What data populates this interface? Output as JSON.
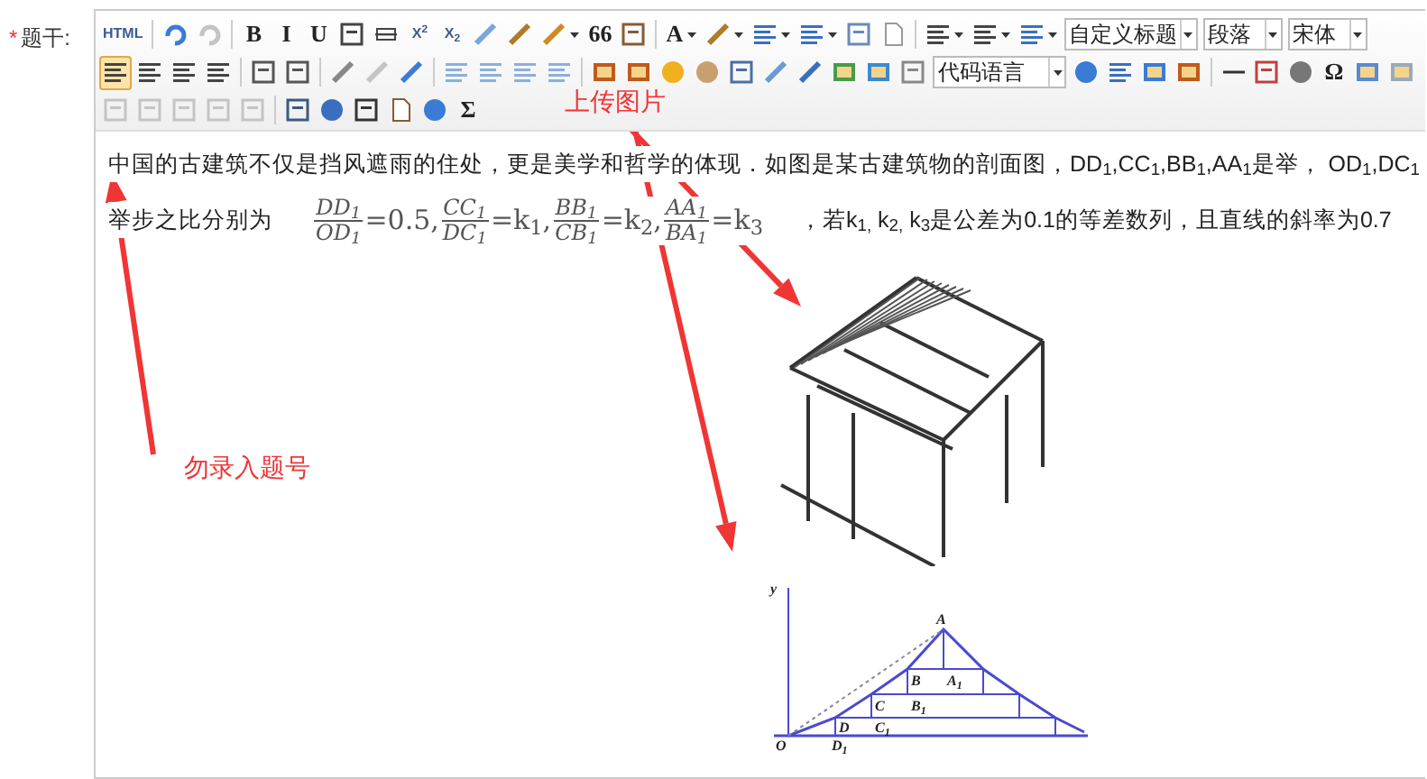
{
  "field": {
    "required_mark": "*",
    "label": "题干:"
  },
  "toolbar": {
    "rows": [
      [
        {
          "kind": "text",
          "label": "HTML"
        },
        {
          "kind": "sep"
        },
        {
          "kind": "icon"
        },
        {
          "kind": "icon",
          "disabled": true
        },
        {
          "kind": "sep"
        },
        {
          "kind": "text",
          "label": "B"
        },
        {
          "kind": "text",
          "label": "I"
        },
        {
          "kind": "text",
          "label": "U"
        },
        {
          "kind": "icon"
        },
        {
          "kind": "icon"
        },
        {
          "kind": "text",
          "label": "X$^{2}$"
        },
        {
          "kind": "text",
          "label": "X$_{2}$"
        },
        {
          "kind": "icon"
        },
        {
          "kind": "icon"
        },
        {
          "kind": "icon",
          "dropdown": true
        },
        {
          "kind": "text",
          "label": "66"
        },
        {
          "kind": "icon"
        },
        {
          "kind": "sep"
        },
        {
          "kind": "text",
          "label": "A",
          "dropdown": true
        },
        {
          "kind": "icon",
          "dropdown": true
        },
        {
          "kind": "icon",
          "dropdown": true
        },
        {
          "kind": "icon",
          "dropdown": true
        },
        {
          "kind": "icon"
        },
        {
          "kind": "icon"
        },
        {
          "kind": "sep"
        },
        {
          "kind": "icon",
          "dropdown": true
        },
        {
          "kind": "icon",
          "dropdown": true
        },
        {
          "kind": "icon",
          "dropdown": true
        },
        {
          "kind": "select",
          "value": "自定义标题"
        },
        {
          "kind": "select",
          "value": "段落"
        },
        {
          "kind": "select",
          "value": "宋体"
        }
      ],
      [
        {
          "kind": "icon",
          "selected": true
        },
        {
          "kind": "icon",
          "selected": false
        },
        {
          "kind": "icon",
          "selected": false
        },
        {
          "kind": "icon",
          "selected": false
        },
        {
          "kind": "sep"
        },
        {
          "kind": "icon"
        },
        {
          "kind": "icon"
        },
        {
          "kind": "sep"
        },
        {
          "kind": "icon"
        },
        {
          "kind": "icon",
          "disabled": true
        },
        {
          "kind": "icon"
        },
        {
          "kind": "sep"
        },
        {
          "kind": "icon"
        },
        {
          "kind": "icon"
        },
        {
          "kind": "icon"
        },
        {
          "kind": "icon"
        },
        {
          "kind": "sep"
        },
        {
          "kind": "icon"
        },
        {
          "kind": "icon"
        },
        {
          "kind": "icon"
        },
        {
          "kind": "icon"
        },
        {
          "kind": "icon"
        },
        {
          "kind": "icon"
        },
        {
          "kind": "icon"
        },
        {
          "kind": "icon"
        },
        {
          "kind": "icon"
        },
        {
          "kind": "icon"
        },
        {
          "kind": "select",
          "value": "代码语言"
        },
        {
          "kind": "icon"
        },
        {
          "kind": "icon"
        },
        {
          "kind": "icon"
        },
        {
          "kind": "icon"
        },
        {
          "kind": "sep"
        },
        {
          "kind": "icon"
        },
        {
          "kind": "icon"
        },
        {
          "kind": "icon"
        },
        {
          "kind": "text",
          "label": "Ω"
        },
        {
          "kind": "icon"
        },
        {
          "kind": "icon"
        }
      ],
      [
        {
          "kind": "icon",
          "disabled": true
        },
        {
          "kind": "icon",
          "disabled": true
        },
        {
          "kind": "icon",
          "disabled": true
        },
        {
          "kind": "icon",
          "disabled": true
        },
        {
          "kind": "icon",
          "disabled": true
        },
        {
          "kind": "sep"
        },
        {
          "kind": "icon"
        },
        {
          "kind": "icon"
        },
        {
          "kind": "icon"
        },
        {
          "kind": "icon"
        },
        {
          "kind": "icon"
        },
        {
          "kind": "text",
          "label": "Σ"
        }
      ]
    ]
  },
  "content": {
    "line_1": "中国的古建筑不仅是挡风遮雨的住处，更是美学和哲学的体现．如图是某古建筑物的剖面图，DD$_{1}$,CC$_{1}$,BB$_{1}$,AA$_{1}$是举， OD$_{1}$,DC$_{1}$",
    "line_2_start": "举步之比分别为",
    "formula": [
      {
        "num": "DD$_{1}$",
        "den": "OD$_{1}$",
        "rhs": "=0.5,"
      },
      {
        "num": "CC$_{1}$",
        "den": "DC$_{1}$",
        "rhs": "=k$_{1}$,"
      },
      {
        "num": "BB$_{1}$",
        "den": "CB$_{1}$",
        "rhs": "=k$_{2}$,"
      },
      {
        "num": "AA$_{1}$",
        "den": "BA$_{1}$",
        "rhs": "=k$_{3}$"
      }
    ],
    "line_2_end": "，若k$_{1,}$ k$_{2,}$ k$_{3}$是公差为0.1的等差数列，且直线的斜率为0.7",
    "diagram": {
      "labels": [
        "y",
        "A",
        "B",
        "A$_{1}$",
        "C",
        "B$_{1}$",
        "D",
        "C$_{1}$",
        "O",
        "D$_{1}$"
      ]
    }
  },
  "annotations": [
    {
      "text": "上传图片"
    },
    {
      "text": "勿录入题号"
    }
  ]
}
